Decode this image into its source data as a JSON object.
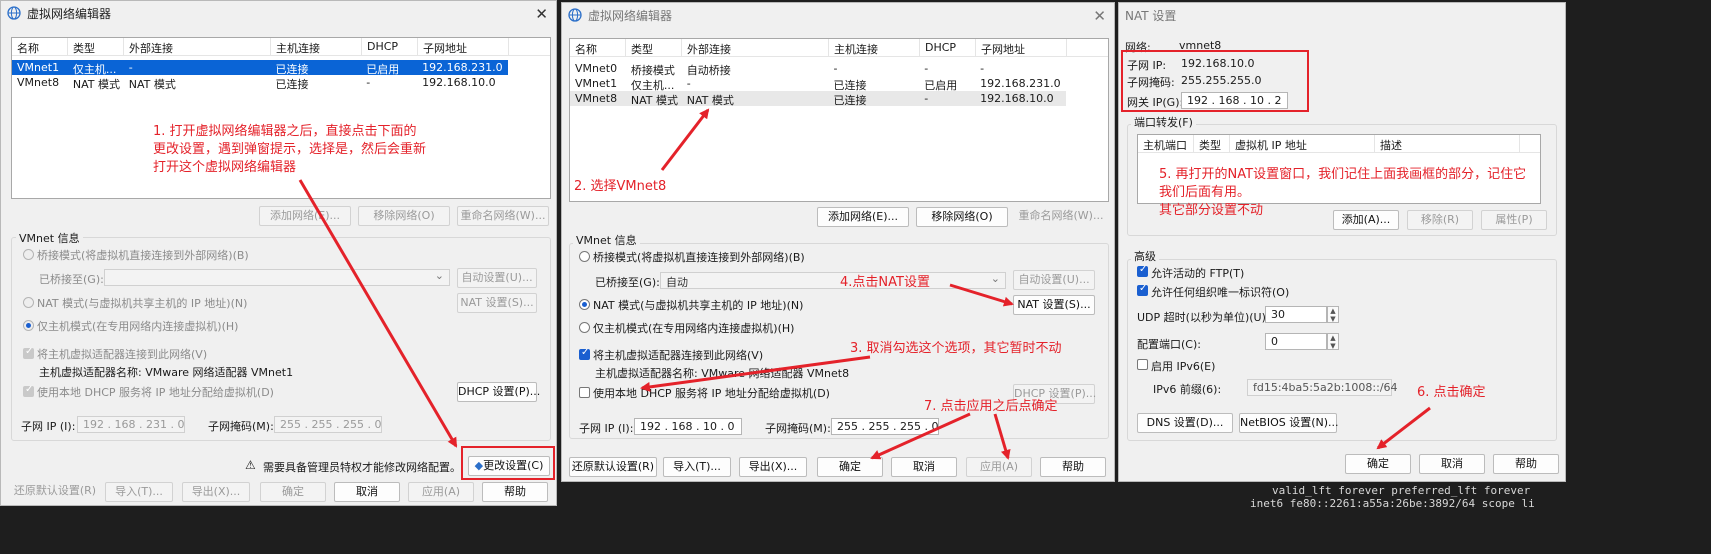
{
  "term": {
    "line1": "valid_lft forever preferred_lft forever",
    "line2": "inet6 fe80::2261:a55a:26be:3892/64 scope li"
  },
  "w1": {
    "title": "虚拟网络编辑器",
    "columns": [
      "名称",
      "类型",
      "外部连接",
      "主机连接",
      "DHCP",
      "子网地址"
    ],
    "rows": [
      [
        "VMnet1",
        "仅主机...",
        "-",
        "已连接",
        "已启用",
        "192.168.231.0"
      ],
      [
        "VMnet8",
        "NAT 模式",
        "NAT 模式",
        "已连接",
        "-",
        "192.168.10.0"
      ]
    ],
    "btn_add": "添加网络(E)...",
    "btn_remove": "移除网络(O)",
    "btn_rename": "重命名网络(W)...",
    "group_label": "VMnet 信息",
    "bridge": "桥接模式(将虚拟机直接连接到外部网络)(B)",
    "bridged_to": "已桥接至(G):",
    "auto_btn": "自动设置(U)...",
    "nat": "NAT 模式(与虚拟机共享主机的 IP 地址)(N)",
    "nat_btn": "NAT 设置(S)...",
    "hostonly": "仅主机模式(在专用网络内连接虚拟机)(H)",
    "connect_adapter": "将主机虚拟适配器连接到此网络(V)",
    "adapter_name": "主机虚拟适配器名称: VMware 网络适配器 VMnet1",
    "use_dhcp": "使用本地 DHCP 服务将 IP 地址分配给虚拟机(D)",
    "dhcp_btn": "DHCP 设置(P)...",
    "subnet_ip_label": "子网 IP (I):",
    "subnet_ip": "192 . 168 . 231 . 0",
    "mask_label": "子网掩码(M):",
    "mask": "255 . 255 . 255 . 0",
    "warning": "需要具备管理员特权才能修改网络配置。",
    "change_btn": "更改设置(C)",
    "restore": "还原默认设置(R)",
    "import": "导入(T)...",
    "export": "导出(X)...",
    "ok": "确定",
    "cancel": "取消",
    "apply": "应用(A)",
    "help": "帮助"
  },
  "w2": {
    "title": "虚拟网络编辑器",
    "columns": [
      "名称",
      "类型",
      "外部连接",
      "主机连接",
      "DHCP",
      "子网地址"
    ],
    "rows": [
      [
        "VMnet0",
        "桥接模式",
        "自动桥接",
        "-",
        "-",
        "-"
      ],
      [
        "VMnet1",
        "仅主机...",
        "-",
        "已连接",
        "已启用",
        "192.168.231.0"
      ],
      [
        "VMnet8",
        "NAT 模式",
        "NAT 模式",
        "已连接",
        "-",
        "192.168.10.0"
      ]
    ],
    "btn_add": "添加网络(E)...",
    "btn_remove": "移除网络(O)",
    "btn_rename": "重命名网络(W)...",
    "group_label": "VMnet 信息",
    "bridge": "桥接模式(将虚拟机直接连接到外部网络)(B)",
    "bridged_to": "已桥接至(G):",
    "bridged_value": "自动",
    "auto_btn": "自动设置(U)...",
    "nat": "NAT 模式(与虚拟机共享主机的 IP 地址)(N)",
    "nat_btn": "NAT 设置(S)...",
    "hostonly": "仅主机模式(在专用网络内连接虚拟机)(H)",
    "connect_adapter": "将主机虚拟适配器连接到此网络(V)",
    "adapter_name": "主机虚拟适配器名称: VMware 网络适配器 VMnet8",
    "use_dhcp": "使用本地 DHCP 服务将 IP 地址分配给虚拟机(D)",
    "dhcp_btn": "DHCP 设置(P)...",
    "subnet_ip_label": "子网 IP (I):",
    "subnet_ip": "192 . 168 . 10 . 0",
    "mask_label": "子网掩码(M):",
    "mask": "255 . 255 . 255 . 0",
    "restore": "还原默认设置(R)",
    "import": "导入(T)...",
    "export": "导出(X)...",
    "ok": "确定",
    "cancel": "取消",
    "apply": "应用(A)",
    "help": "帮助"
  },
  "w3": {
    "title": "NAT 设置",
    "network_label": "网络:",
    "network": "vmnet8",
    "subnet_ip_label": "子网 IP:",
    "subnet_ip": "192.168.10.0",
    "mask_label": "子网掩码:",
    "mask": "255.255.255.0",
    "gateway_label": "网关 IP(G):",
    "gateway": "192 . 168 . 10 . 2",
    "port_fwd": "端口转发(F)",
    "pf_columns": [
      "主机端口",
      "类型",
      "虚拟机 IP 地址",
      "描述"
    ],
    "add": "添加(A)...",
    "remove": "移除(R)",
    "props": "属性(P)",
    "advanced": "高级",
    "allow_ftp": "允许活动的 FTP(T)",
    "allow_org": "允许任何组织唯一标识符(O)",
    "udp_label": "UDP 超时(以秒为单位)(U):",
    "udp": "30",
    "config_port_label": "配置端口(C):",
    "config_port": "0",
    "ipv6": "启用 IPv6(E)",
    "ipv6_prefix_label": "IPv6 前缀(6):",
    "ipv6_prefix": "fd15:4ba5:5a2b:1008::/64",
    "dns": "DNS 设置(D)...",
    "netbios": "NetBIOS 设置(N)...",
    "ok": "确定",
    "cancel": "取消",
    "help": "帮助"
  },
  "annotations": {
    "a1": [
      "1. 打开虚拟网络编辑器之后，直接点击下面的",
      "更改设置，遇到弹窗提示，选择是，然后会重新",
      "打开这个虚拟网络编辑器"
    ],
    "a2": "2. 选择VMnet8",
    "a3": "3. 取消勾选这个选项，其它暂时不动",
    "a4": "4.点击NAT设置",
    "a5": [
      "5. 再打开的NAT设置窗口，我们记住上面我画框的部分，记住它",
      "我们后面有用。",
      "其它部分设置不动"
    ],
    "a6": "6. 点击确定",
    "a7": "7. 点击应用之后点确定"
  },
  "colors": {
    "annotation": "#e4222a",
    "selection": "#0a64d6",
    "window_bg": "#f0f0f0"
  }
}
